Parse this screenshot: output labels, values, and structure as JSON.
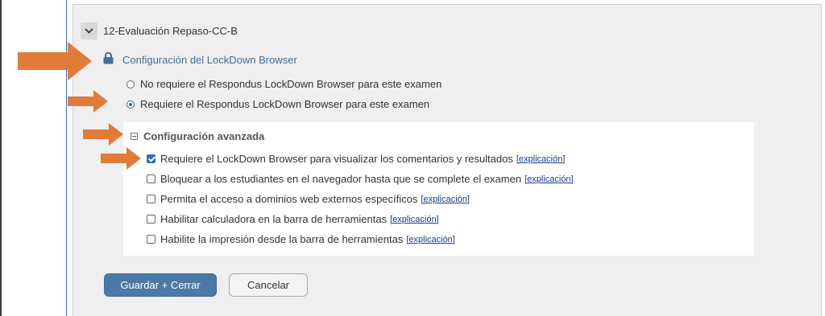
{
  "exam": {
    "title": "12-Evaluación Repaso-CC-B"
  },
  "lockdown": {
    "link_label": "Configuración del LockDown Browser",
    "radio_options": [
      {
        "label": "No requiere el Respondus LockDown Browser para este examen",
        "selected": false
      },
      {
        "label": "Requiere el Respondus LockDown Browser para este examen",
        "selected": true
      }
    ]
  },
  "advanced": {
    "header": "Configuración avanzada",
    "options": [
      {
        "label": "Requiere el LockDown Browser para visualizar los comentarios y resultados",
        "link": "[explicación]",
        "checked": true
      },
      {
        "label": "Bloquear a los estudiantes en el navegador hasta que se complete el examen",
        "link": "[explicación]",
        "checked": false
      },
      {
        "label": "Permita el acceso a dominios web externos específicos",
        "link": "[explicación]",
        "checked": false
      },
      {
        "label": "Habilitar calculadora en la barra de herramientas",
        "link": "[explicación]",
        "checked": false
      },
      {
        "label": "Habilite la impresión desde la barra de herramientas",
        "link": "[explicación]",
        "checked": false
      }
    ]
  },
  "buttons": {
    "save": "Guardar + Cerrar",
    "cancel": "Cancelar"
  },
  "colors": {
    "arrow": "#e07b39",
    "link": "#3d6f9a",
    "primary": "#4a79a8",
    "checked": "#2f6bd3"
  },
  "icons": {
    "collapse": "chevron-down-icon",
    "lock": "lock-icon",
    "advanced_toggle": "minus-square-icon"
  }
}
